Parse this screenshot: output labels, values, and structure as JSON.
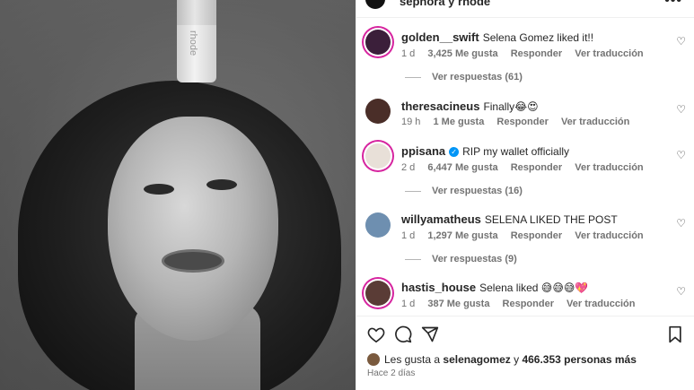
{
  "header": {
    "title": "sephora y rhode",
    "more_label": "•••"
  },
  "photo": {
    "bottle_brand": "rhode"
  },
  "comments": [
    {
      "user": "golden__swift",
      "text": "Selena Gomez liked it!!",
      "time": "1 d",
      "likes": "3,425 Me gusta",
      "reply": "Responder",
      "translate": "Ver traducción",
      "replies": "Ver respuestas (61)",
      "avatar_color": "#3b1f3a",
      "story": true
    },
    {
      "user": "theresacineus",
      "text": "Finally😂😍",
      "time": "19 h",
      "likes": "1 Me gusta",
      "reply": "Responder",
      "translate": "Ver traducción",
      "avatar_color": "#4a2e28",
      "story": false
    },
    {
      "user": "ppisana",
      "verified": true,
      "text": "RIP my wallet officially",
      "time": "2 d",
      "likes": "6,447 Me gusta",
      "reply": "Responder",
      "translate": "Ver traducción",
      "replies": "Ver respuestas (16)",
      "avatar_color": "#e8e0d8",
      "story": true
    },
    {
      "user": "willyamatheus",
      "text": "SELENA LIKED THE POST",
      "time": "1 d",
      "likes": "1,297 Me gusta",
      "reply": "Responder",
      "translate": "Ver traducción",
      "replies": "Ver respuestas (9)",
      "avatar_color": "#6e8fb0",
      "story": false
    },
    {
      "user": "hastis_house",
      "text": "Selena liked 😅😅😅💖",
      "time": "1 d",
      "likes": "387 Me gusta",
      "reply": "Responder",
      "translate": "Ver traducción",
      "avatar_color": "#5a3c36",
      "story": true
    }
  ],
  "actions": {
    "like_icon": "heart-icon",
    "comment_icon": "comment-icon",
    "share_icon": "send-icon",
    "save_icon": "bookmark-icon"
  },
  "likes_summary": {
    "prefix": "Les gusta a",
    "user": "selenagomez",
    "connector": "y",
    "count": "466.353 personas más"
  },
  "posted": "Hace 2 días"
}
